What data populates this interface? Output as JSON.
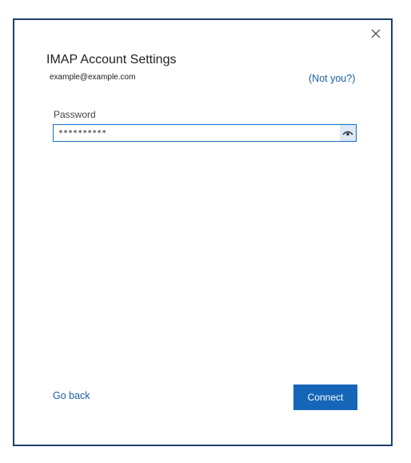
{
  "dialog": {
    "title": "IMAP Account Settings",
    "email": "example@example.com",
    "not_you_label": "(Not you?)",
    "password_label": "Password",
    "password_value": "**********",
    "go_back_label": "Go back",
    "connect_label": "Connect",
    "icons": {
      "close": "close-icon",
      "show_password": "eye-icon"
    },
    "colors": {
      "accent": "#1566b7",
      "link": "#1a5ea8",
      "frame": "#1f3f66"
    }
  }
}
